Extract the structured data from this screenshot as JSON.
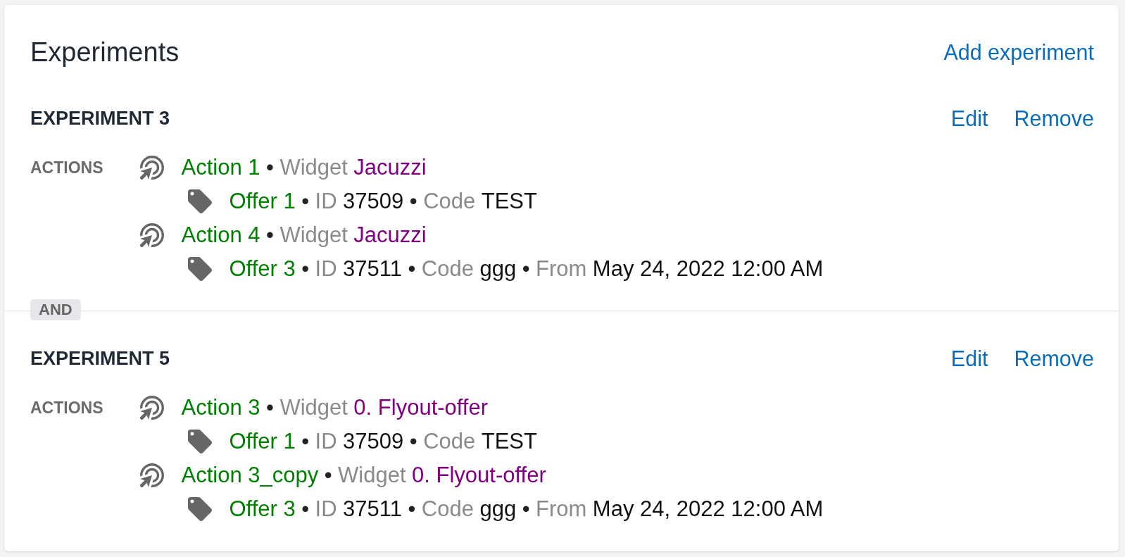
{
  "header": {
    "title": "Experiments",
    "add_link": "Add experiment"
  },
  "experiments": [
    {
      "title": "EXPERIMENT 3",
      "edit_link": "Edit",
      "remove_link": "Remove",
      "actions_label": "ACTIONS",
      "actions": [
        {
          "name": "Action 1",
          "details": [
            {
              "separator": "•",
              "label": "Widget",
              "value": "Jacuzzi",
              "kind": "widget"
            }
          ],
          "offers": [
            {
              "name": "Offer 1",
              "details": [
                {
                  "separator": "•",
                  "label": "ID",
                  "value": "37509",
                  "kind": "field"
                },
                {
                  "separator": "•",
                  "label": "Code",
                  "value": "TEST",
                  "kind": "field"
                }
              ]
            }
          ]
        },
        {
          "name": "Action 4",
          "details": [
            {
              "separator": "•",
              "label": "Widget",
              "value": "Jacuzzi",
              "kind": "widget"
            }
          ],
          "offers": [
            {
              "name": "Offer 3",
              "details": [
                {
                  "separator": "•",
                  "label": "ID",
                  "value": "37511",
                  "kind": "field"
                },
                {
                  "separator": "•",
                  "label": "Code",
                  "value": "ggg",
                  "kind": "field"
                },
                {
                  "separator": "•",
                  "label": "From",
                  "value": "May 24, 2022 12:00 AM",
                  "kind": "field"
                }
              ]
            }
          ]
        }
      ]
    },
    {
      "joiner": "AND",
      "title": "EXPERIMENT 5",
      "edit_link": "Edit",
      "remove_link": "Remove",
      "actions_label": "ACTIONS",
      "actions": [
        {
          "name": "Action 3",
          "details": [
            {
              "separator": "•",
              "label": "Widget",
              "value": "0. Flyout-offer",
              "kind": "widget"
            }
          ],
          "offers": [
            {
              "name": "Offer 1",
              "details": [
                {
                  "separator": "•",
                  "label": "ID",
                  "value": "37509",
                  "kind": "field"
                },
                {
                  "separator": "•",
                  "label": "Code",
                  "value": "TEST",
                  "kind": "field"
                }
              ]
            }
          ]
        },
        {
          "name": "Action 3_copy",
          "details": [
            {
              "separator": "•",
              "label": "Widget",
              "value": "0. Flyout-offer",
              "kind": "widget"
            }
          ],
          "offers": [
            {
              "name": "Offer 3",
              "details": [
                {
                  "separator": "•",
                  "label": "ID",
                  "value": "37511",
                  "kind": "field"
                },
                {
                  "separator": "•",
                  "label": "Code",
                  "value": "ggg",
                  "kind": "field"
                },
                {
                  "separator": "•",
                  "label": "From",
                  "value": "May 24, 2022 12:00 AM",
                  "kind": "field"
                }
              ]
            }
          ]
        }
      ]
    }
  ]
}
